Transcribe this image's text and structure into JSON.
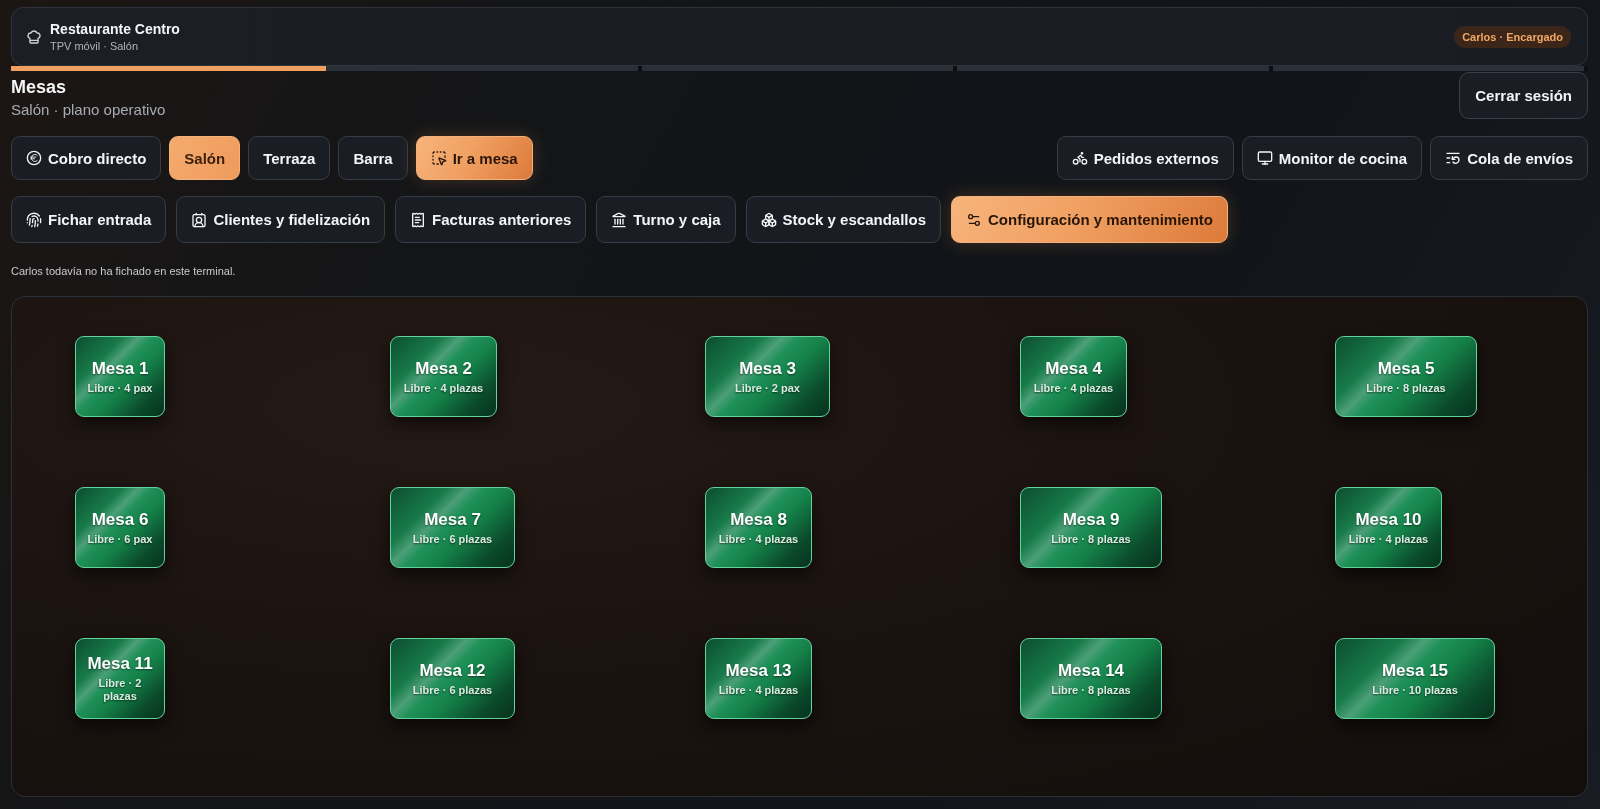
{
  "header": {
    "title": "Restaurante Centro",
    "subtitle": "TPV móvil · Salón",
    "user_badge": "Carlos · Encargado",
    "progress": {
      "level": 0.2
    }
  },
  "page": {
    "title": "Mesas",
    "subtitle": "Salón · plano operativo",
    "logout_button": "Cerrar sesión"
  },
  "actions_left": [
    {
      "kind": "action",
      "label": "Cobro directo"
    },
    {
      "kind": "zone",
      "label": "Salón",
      "selected": true
    },
    {
      "kind": "zone",
      "label": "Terraza",
      "selected": false
    },
    {
      "kind": "zone",
      "label": "Barra",
      "selected": false
    },
    {
      "kind": "primary",
      "label": "Ir a mesa"
    }
  ],
  "actions_right": [
    "Pedidos externos",
    "Monitor de cocina",
    "Cola de envíos"
  ],
  "modules": [
    {
      "kind": "action",
      "label": "Fichar entrada"
    },
    {
      "kind": "action",
      "label": "Clientes y fidelización"
    },
    {
      "kind": "action",
      "label": "Facturas anteriores"
    },
    {
      "kind": "action",
      "label": "Turno y caja"
    },
    {
      "kind": "action",
      "label": "Stock y escandallos"
    },
    {
      "kind": "primary",
      "label": "Configuración y mantenimiento"
    }
  ],
  "notice": "Carlos todavía no ha fichado en este terminal.",
  "floor": {
    "tables": [
      {
        "name": "Mesa 1",
        "detail": "Libre · 4 pax",
        "kind": "small"
      },
      {
        "name": "Mesa 2",
        "detail": "Libre · 4 plazas",
        "kind": "medium"
      },
      {
        "name": "Mesa 3",
        "detail": "Libre · 2 pax",
        "kind": "large"
      },
      {
        "name": "Mesa 4",
        "detail": "Libre · 4 plazas",
        "kind": "medium"
      },
      {
        "name": "Mesa 5",
        "detail": "Libre · 8 plazas",
        "kind": "xlarge"
      },
      {
        "name": "Mesa 6",
        "detail": "Libre · 6 pax",
        "kind": "small"
      },
      {
        "name": "Mesa 7",
        "detail": "Libre · 6 plazas",
        "kind": "large"
      },
      {
        "name": "Mesa 8",
        "detail": "Libre · 4 plazas",
        "kind": "medium"
      },
      {
        "name": "Mesa 9",
        "detail": "Libre · 8 plazas",
        "kind": "xlarge"
      },
      {
        "name": "Mesa 10",
        "detail": "Libre · 4 plazas",
        "kind": "medium"
      },
      {
        "name": "Mesa 11",
        "detail": "Libre · 2 plazas",
        "kind": "small"
      },
      {
        "name": "Mesa 12",
        "detail": "Libre · 6 plazas",
        "kind": "large"
      },
      {
        "name": "Mesa 13",
        "detail": "Libre · 4 plazas",
        "kind": "medium"
      },
      {
        "name": "Mesa 14",
        "detail": "Libre · 8 plazas",
        "kind": "xlarge"
      },
      {
        "name": "Mesa 15",
        "detail": "Libre · 10 plazas",
        "kind": "xxlarge"
      }
    ]
  }
}
